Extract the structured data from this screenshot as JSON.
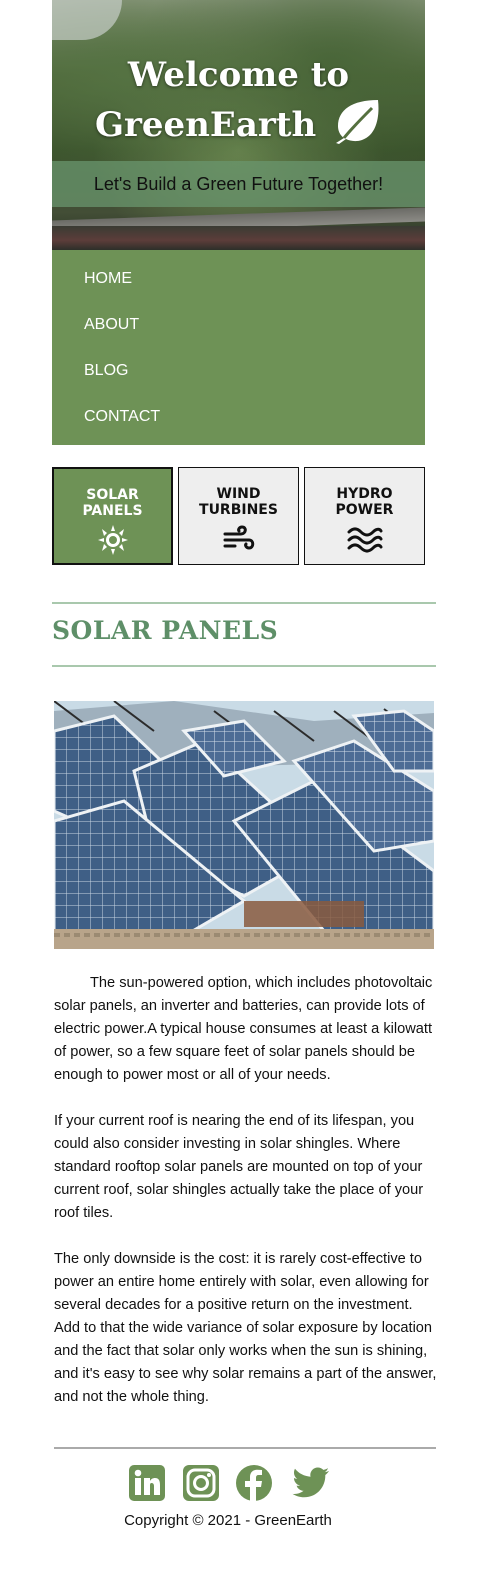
{
  "header": {
    "title_line1": "Welcome to",
    "title_line2": "GreenEarth",
    "tagline": "Let's Build a Green Future Together!"
  },
  "nav": {
    "items": [
      "HOME",
      "ABOUT",
      "BLOG",
      "CONTACT"
    ]
  },
  "tabs": [
    {
      "line1": "SOLAR",
      "line2": "PANELS",
      "icon": "sun-icon",
      "active": true
    },
    {
      "line1": "WIND",
      "line2": "TURBINES",
      "icon": "wind-icon",
      "active": false
    },
    {
      "line1": "HYDRO",
      "line2": "POWER",
      "icon": "water-icon",
      "active": false
    }
  ],
  "section": {
    "title": "SOLAR PANELS",
    "paragraphs": [
      "The sun-powered option, which includes photovoltaic solar panels, an inverter and batteries, can provide lots of electric power.A typical house consumes at least a kilowatt of power, so a few square feet of solar panels should be enough to power most or all of your needs.",
      "If your current roof is nearing the end of its lifespan, you could also consider investing in solar shingles. Where standard rooftop solar panels are mounted on top of your current roof, solar shingles actually take the place of your roof tiles.",
      "The only downside is the cost: it is rarely cost-effective to power an entire home entirely with solar, even allowing for several decades for a positive return on the investment. Add to that the wide variance of solar exposure by location and the fact that solar only works when the sun is shining, and it's easy to see why solar remains a part of the answer, and not the whole thing."
    ]
  },
  "footer": {
    "socials": [
      "linkedin-icon",
      "instagram-icon",
      "facebook-icon",
      "twitter-icon"
    ],
    "copyright": "Copyright © 2021 - GreenEarth"
  },
  "colors": {
    "accent_green": "#6e9256",
    "title_green": "#5e8f68",
    "rule_green": "#a9c8ad",
    "tab_inactive": "#eeeeee"
  }
}
